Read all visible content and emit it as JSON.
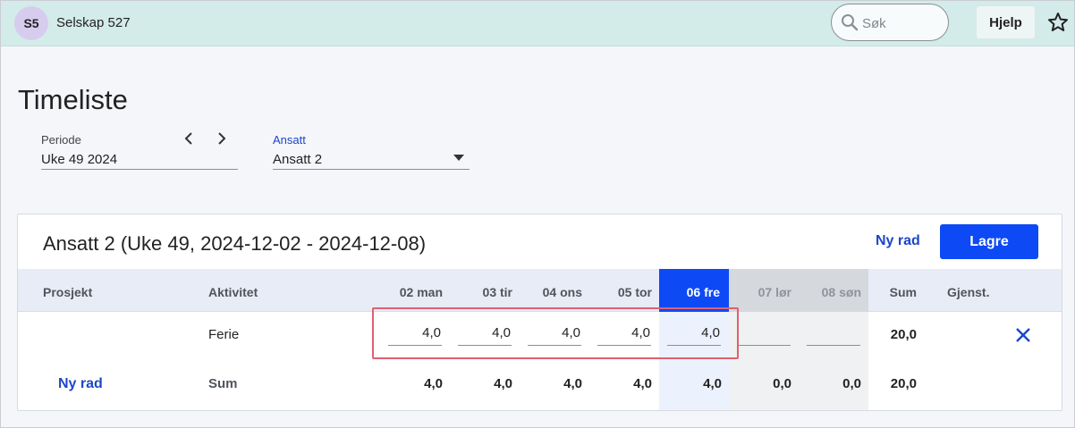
{
  "header": {
    "avatar": "S5",
    "company": "Selskap 527",
    "search_placeholder": "Søk",
    "help_label": "Hjelp"
  },
  "page": {
    "title": "Timeliste",
    "periode_label": "Periode",
    "periode_value": "Uke 49 2024",
    "ansatt_label": "Ansatt",
    "ansatt_value": "Ansatt 2"
  },
  "card": {
    "title": "Ansatt 2 (Uke 49, 2024-12-02 - 2024-12-08)",
    "new_row_label": "Ny rad",
    "save_label": "Lagre"
  },
  "table": {
    "headers": {
      "project": "Prosjekt",
      "activity": "Aktivitet",
      "days": [
        "02 man",
        "03 tir",
        "04 ons",
        "05 tor",
        "06 fre",
        "07 lør",
        "08 søn"
      ],
      "sum": "Sum",
      "remaining": "Gjenst."
    },
    "row": {
      "project": "",
      "activity": "Ferie",
      "hours": [
        "4,0",
        "4,0",
        "4,0",
        "4,0",
        "4,0",
        "",
        ""
      ],
      "sum": "20,0"
    },
    "sum_row": {
      "new_row_label": "Ny rad",
      "label": "Sum",
      "values": [
        "4,0",
        "4,0",
        "4,0",
        "4,0",
        "4,0",
        "0,0",
        "0,0"
      ],
      "total": "20,0"
    },
    "today_index": 4
  },
  "colors": {
    "accent": "#0d4af5",
    "header_bg": "#d3ebe9",
    "highlight": "#e06070"
  }
}
